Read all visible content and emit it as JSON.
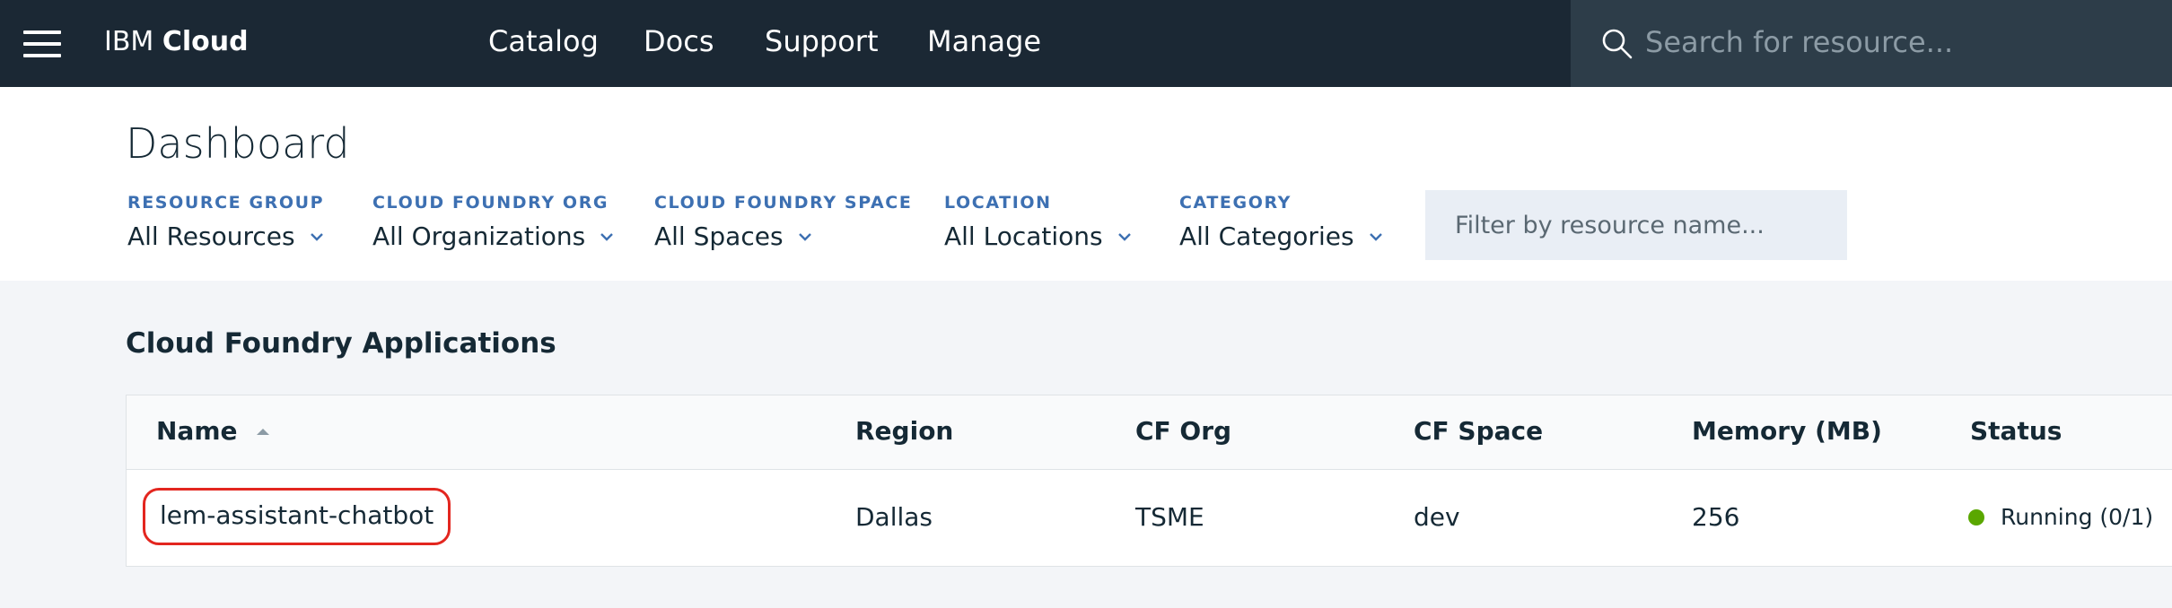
{
  "topbar": {
    "brand_prefix": "IBM",
    "brand_name": "Cloud",
    "nav": [
      "Catalog",
      "Docs",
      "Support",
      "Manage"
    ],
    "search_placeholder": "Search for resource..."
  },
  "page": {
    "title": "Dashboard"
  },
  "filters": [
    {
      "label": "RESOURCE GROUP",
      "value": "All Resources"
    },
    {
      "label": "CLOUD FOUNDRY ORG",
      "value": "All Organizations"
    },
    {
      "label": "CLOUD FOUNDRY SPACE",
      "value": "All Spaces"
    },
    {
      "label": "LOCATION",
      "value": "All Locations"
    },
    {
      "label": "CATEGORY",
      "value": "All Categories"
    }
  ],
  "filter_input": {
    "placeholder": "Filter by resource name..."
  },
  "section": {
    "title": "Cloud Foundry Applications",
    "columns": [
      "Name",
      "Region",
      "CF Org",
      "CF Space",
      "Memory (MB)",
      "Status"
    ],
    "rows": [
      {
        "name": "lem-assistant-chatbot",
        "region": "Dallas",
        "cf_org": "TSME",
        "cf_space": "dev",
        "memory": "256",
        "status": "Running (0/1)",
        "status_color": "#5aa700"
      }
    ]
  },
  "colors": {
    "topbar": "#1b2834",
    "search_bg": "#2d3d49",
    "accent_label": "#3d70b2",
    "highlight_border": "#e3261f"
  },
  "icons": {
    "menu": "hamburger-menu-icon",
    "search": "search-icon",
    "chevron": "chevron-down-icon",
    "sort": "sort-ascending-icon",
    "status": "status-dot-icon"
  }
}
